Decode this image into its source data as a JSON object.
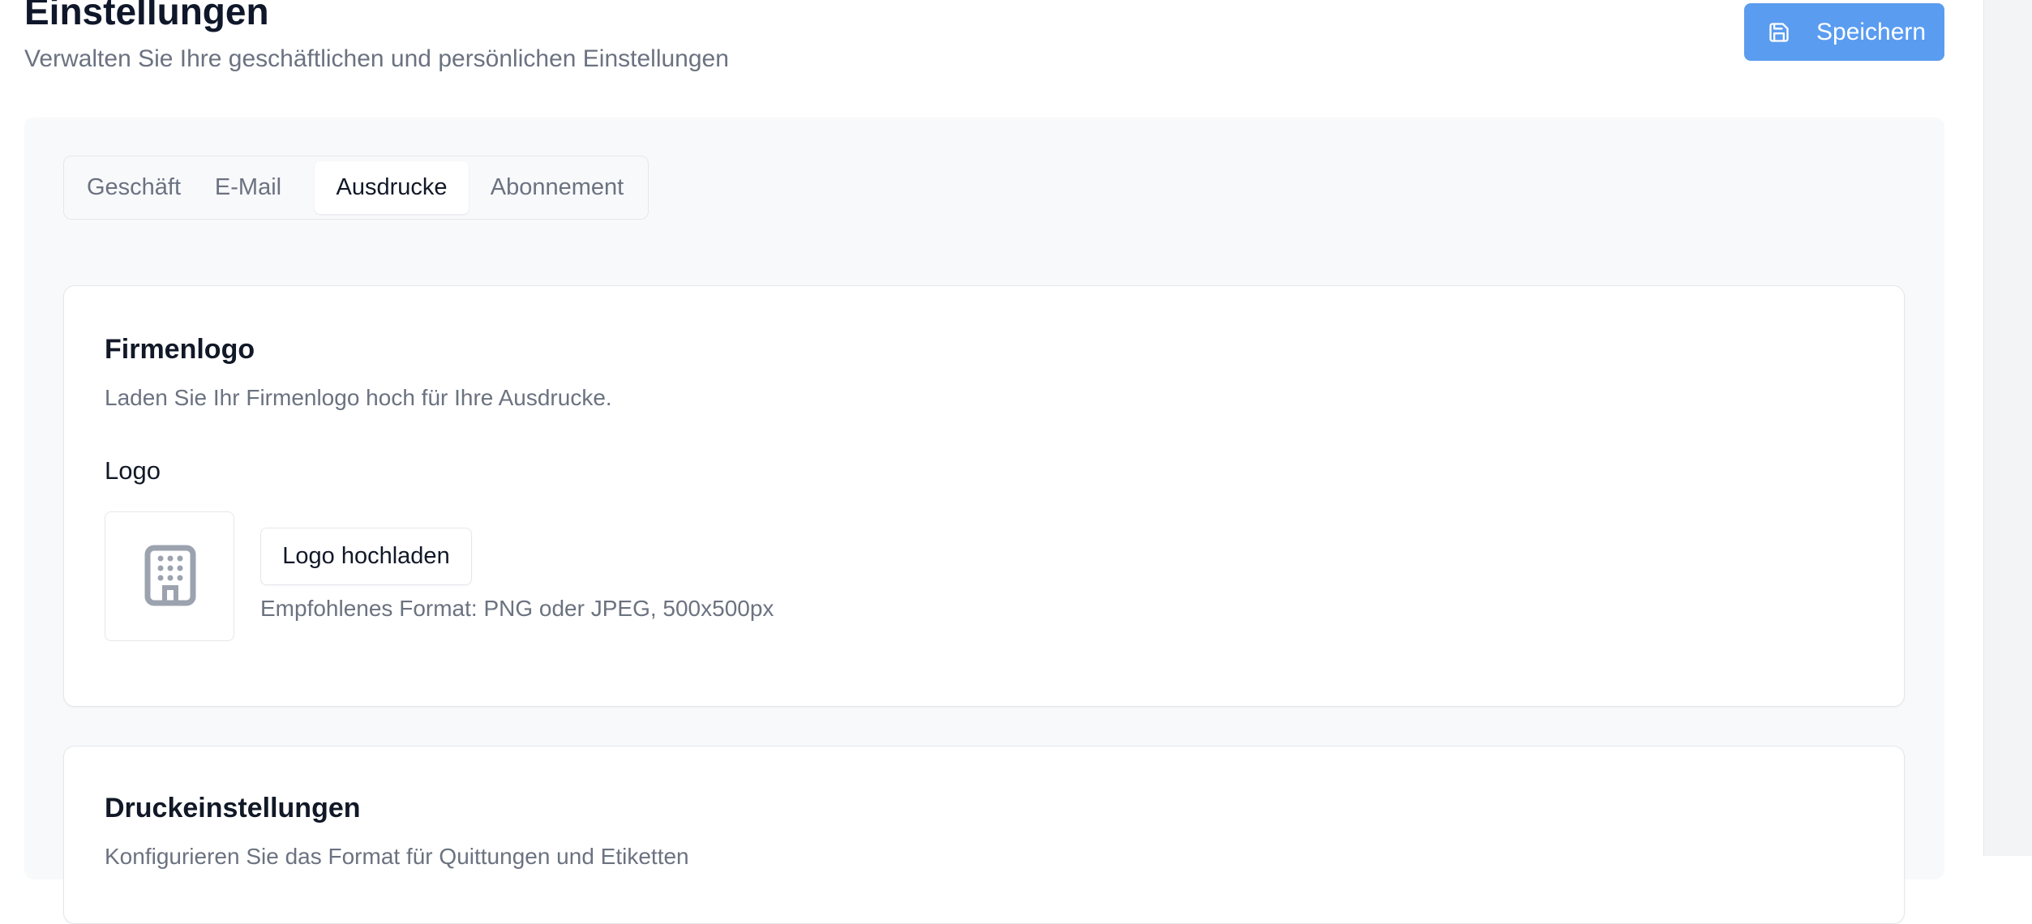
{
  "header": {
    "title": "Einstellungen",
    "subtitle": "Verwalten Sie Ihre geschäftlichen und persönlichen Einstellungen",
    "save_button": {
      "label": "Speichern",
      "icon": "save-icon"
    }
  },
  "tabs": [
    {
      "label": "Geschäft",
      "active": false
    },
    {
      "label": "E-Mail",
      "active": false
    },
    {
      "label": "Ausdrucke",
      "active": true
    },
    {
      "label": "Abonnement",
      "active": false
    }
  ],
  "cards": {
    "company_logo": {
      "title": "Firmenlogo",
      "description": "Laden Sie Ihr Firmenlogo hoch für Ihre Ausdrucke.",
      "field_label": "Logo",
      "preview_icon": "building-icon",
      "upload_button": "Logo hochladen",
      "hint": "Empfohlenes Format: PNG oder JPEG, 500x500px"
    },
    "print_settings": {
      "title": "Druckeinstellungen",
      "description": "Konfigurieren Sie das Format für Quittungen und Etiketten"
    }
  },
  "colors": {
    "primary": "#5a9cf0",
    "page_background": "#ffffff",
    "panel_background": "#f8f9fb",
    "muted_text": "#6b7280",
    "border": "#e5e7eb"
  }
}
